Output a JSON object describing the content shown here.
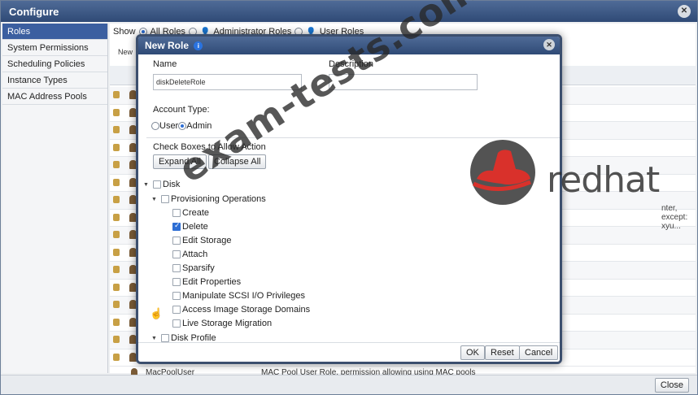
{
  "configure": {
    "title": "Configure",
    "close_glyph": "✕",
    "nav": [
      "Roles",
      "System Permissions",
      "Scheduling Policies",
      "Instance Types",
      "MAC Address Pools"
    ],
    "show_label": "Show",
    "filters": [
      "All Roles",
      "Administrator Roles",
      "User Roles"
    ],
    "toolbar_new": "New",
    "bg_partial_text": "nter, except: xyu...",
    "last_row_name": "MacPoolUser",
    "last_row_desc": "MAC Pool User Role, permission allowing using MAC pools",
    "close_button": "Close"
  },
  "dialog": {
    "title": "New Role",
    "name_label": "Name",
    "name_value": "diskDeleteRole",
    "description_label": "Description",
    "description_value": "",
    "account_type_label": "Account Type:",
    "account_user": "User",
    "account_admin": "Admin",
    "check_boxes_label": "Check Boxes to Allow Action",
    "expand_all": "Expand All",
    "collapse_all": "Collapse All",
    "tree": {
      "disk": "Disk",
      "provisioning": "Provisioning Operations",
      "create": "Create",
      "delete": "Delete",
      "edit_storage": "Edit Storage",
      "attach": "Attach",
      "sparsify": "Sparsify",
      "edit_properties": "Edit Properties",
      "scsi": "Manipulate SCSI I/O Privileges",
      "access_image": "Access Image Storage Domains",
      "live_migration": "Live Storage Migration",
      "disk_profile": "Disk Profile"
    },
    "ok": "OK",
    "reset": "Reset",
    "cancel": "Cancel"
  },
  "watermark": "exam-tests.com",
  "logo_text": "redhat",
  "colors": {
    "accent": "#2d6ed4",
    "titlebar": "#3b5585",
    "logo_red": "#d9312b"
  }
}
